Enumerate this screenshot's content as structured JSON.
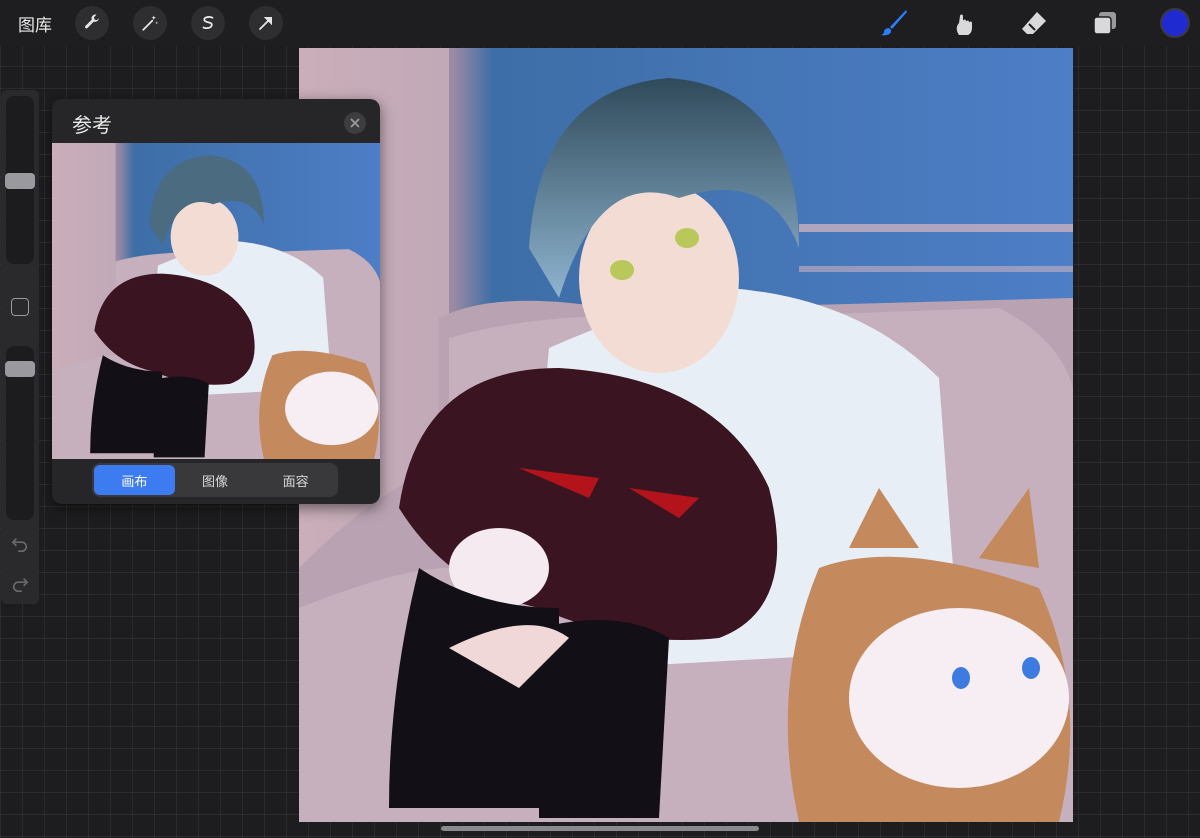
{
  "topbar": {
    "gallery_label": "图库",
    "left_tools": [
      "wrench-icon",
      "magic-wand-icon",
      "selection-icon",
      "transform-arrow-icon"
    ],
    "right_tools": [
      "brush-icon",
      "smudge-icon",
      "eraser-icon",
      "layers-icon"
    ],
    "current_color": "#1f2bd1"
  },
  "sidebar": {
    "size_slider_level": 0.47,
    "opacity_slider_level": 0.88
  },
  "reference": {
    "title": "参考",
    "tabs": [
      {
        "label": "画布",
        "active": true
      },
      {
        "label": "图像",
        "active": false
      },
      {
        "label": "面容",
        "active": false
      }
    ]
  },
  "colors": {
    "accent": "#3d7bf0",
    "active_brush": "#2b7fff"
  }
}
